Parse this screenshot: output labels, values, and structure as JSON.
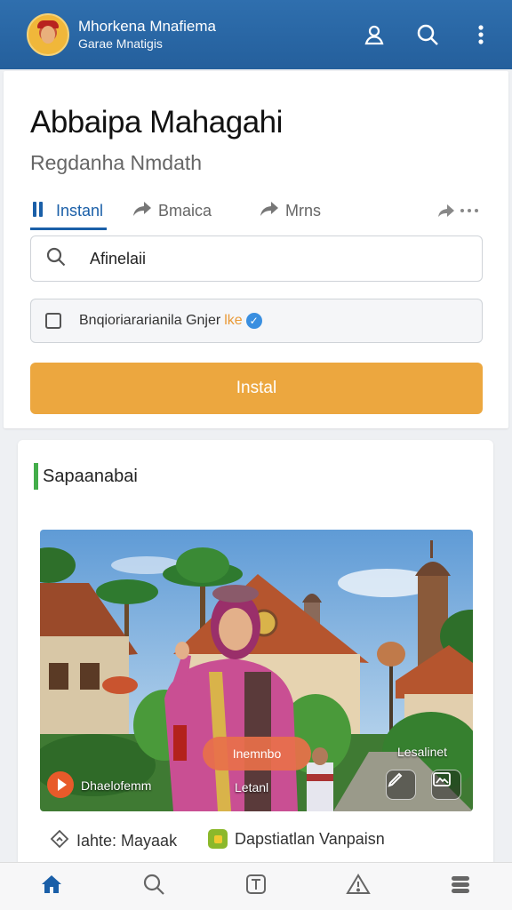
{
  "header": {
    "app_name": "Mhorkena Mnafiema",
    "app_subtitle": "Garae Mnatigis",
    "icons": [
      "user-icon",
      "search-icon",
      "more-vert-icon"
    ],
    "color": "#2f6fae"
  },
  "page": {
    "title": "Abbaipa Mahagahi",
    "subtitle": "Regdanha Nmdath"
  },
  "tabs": [
    {
      "label": "Instanl",
      "icon": "bars-icon",
      "active": true
    },
    {
      "label": "Bmaica",
      "icon": "share-icon"
    },
    {
      "label": "Mrns",
      "icon": "share-icon"
    },
    {
      "label": "",
      "icon": "more-icon"
    }
  ],
  "search": {
    "value": "Afinelaii"
  },
  "checkbox": {
    "label": "Bnqioriararianila Gnjer",
    "highlight": "lke",
    "checked": false
  },
  "install_button": {
    "label": "Instal",
    "color": "#eca73f"
  },
  "section": {
    "title": "Sapaanabai",
    "accent": "#43ad4a"
  },
  "media": {
    "cta_label": "Inemnbo",
    "caption_left": "Dhaelofemm",
    "caption_center": "Letanl",
    "caption_right": "Lesalinet"
  },
  "meta": [
    {
      "icon": "share-icon",
      "label": "Iahte: Mayaak"
    },
    {
      "icon": "app-icon",
      "label": "Dapstiatlan Vanpaisn"
    }
  ],
  "bottom_nav": [
    {
      "icon": "home-icon",
      "active": true
    },
    {
      "icon": "search-icon"
    },
    {
      "icon": "text-box-icon"
    },
    {
      "icon": "warning-icon"
    },
    {
      "icon": "stack-icon"
    }
  ]
}
